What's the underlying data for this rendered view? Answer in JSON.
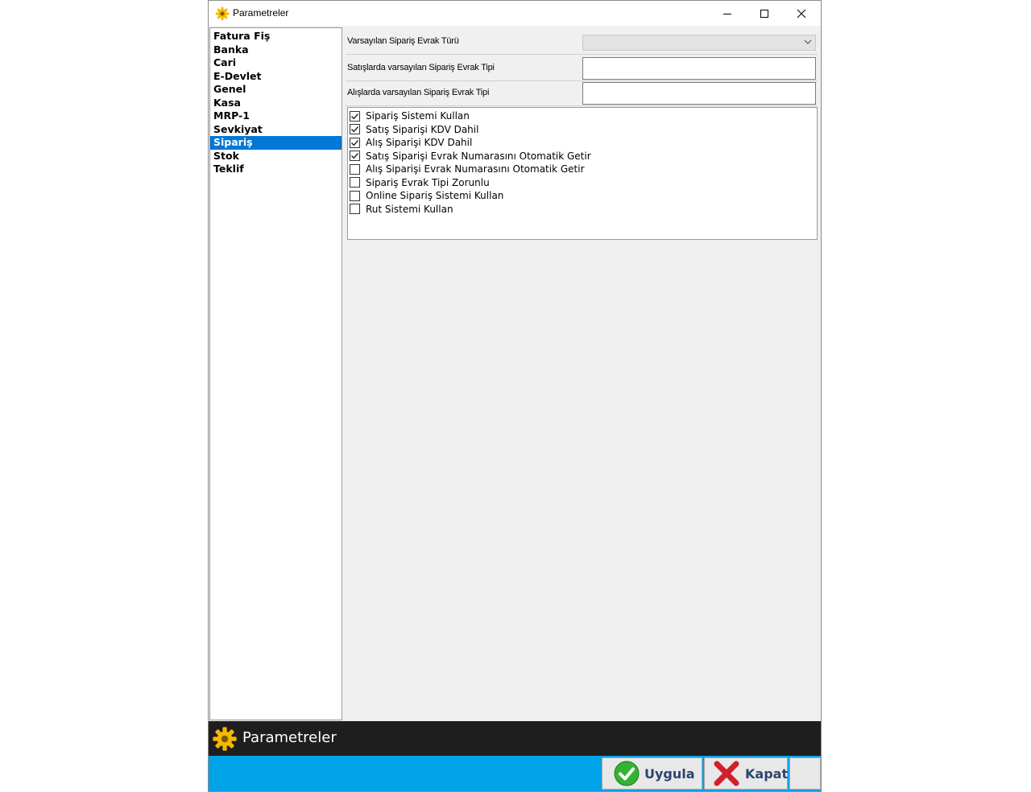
{
  "window": {
    "title": "Parametreler",
    "controls": [
      "minimize",
      "maximize",
      "close"
    ]
  },
  "nav": {
    "items": [
      {
        "label": "Fatura Fiş",
        "selected": false
      },
      {
        "label": "Banka",
        "selected": false
      },
      {
        "label": "Cari",
        "selected": false
      },
      {
        "label": "E-Devlet",
        "selected": false
      },
      {
        "label": "Genel",
        "selected": false
      },
      {
        "label": "Kasa",
        "selected": false
      },
      {
        "label": "MRP-1",
        "selected": false
      },
      {
        "label": "Sevkiyat",
        "selected": false
      },
      {
        "label": "Sipariş",
        "selected": true
      },
      {
        "label": "Stok",
        "selected": false
      },
      {
        "label": "Teklif",
        "selected": false
      }
    ]
  },
  "form": {
    "default_order_doc_type": {
      "label": "Varsayılan Sipariş Evrak Türü",
      "value": ""
    },
    "sales_default_order_doc_kind": {
      "label": "Satışlarda varsayılan Sipariş Evrak Tipi",
      "value": ""
    },
    "purchase_default_order_doc_kind": {
      "label": "Alışlarda varsayılan Sipariş Evrak Tipi",
      "value": ""
    }
  },
  "checkboxes": [
    {
      "label": "Sipariş Sistemi Kullan",
      "checked": true
    },
    {
      "label": "Satış Siparişi KDV Dahil",
      "checked": true
    },
    {
      "label": "Alış Siparişi KDV Dahil",
      "checked": true
    },
    {
      "label": "Satış Siparişi Evrak Numarasını Otomatik Getir",
      "checked": true
    },
    {
      "label": "Alış Siparişi Evrak Numarasını Otomatik Getir",
      "checked": false
    },
    {
      "label": "Sipariş Evrak Tipi Zorunlu",
      "checked": false
    },
    {
      "label": "Online Sipariş Sistemi Kullan",
      "checked": false
    },
    {
      "label": "Rut Sistemi Kullan",
      "checked": false
    }
  ],
  "footer": {
    "title": "Parametreler",
    "apply_label": "Uygula",
    "close_label": "Kapat",
    "apply_icon": "check-icon",
    "close_icon": "x-icon",
    "app_icon": "gear-icon"
  },
  "colors": {
    "selection": "#0078d7",
    "footer_dark": "#1e1e1e",
    "footer_blue": "#00a2e8",
    "gear": "#f5b800",
    "check_green": "#34b233",
    "close_red": "#d0202c"
  }
}
